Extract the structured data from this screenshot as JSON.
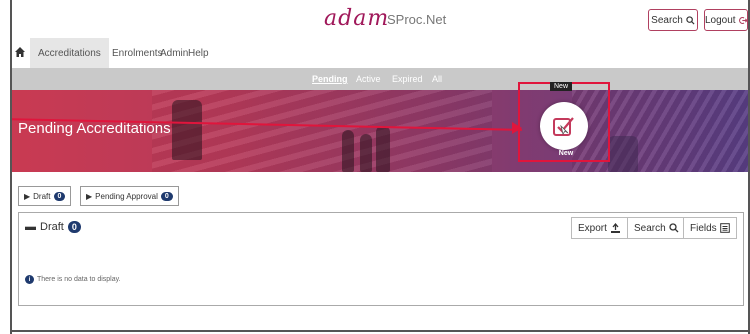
{
  "header": {
    "logo": "adam",
    "product": "SProc.Net",
    "search_label": "Search",
    "logout_label": "Logout"
  },
  "nav": {
    "items": [
      {
        "label": "Accreditations"
      },
      {
        "label": "Enrolments"
      },
      {
        "label": "Admin"
      },
      {
        "label": "Help"
      }
    ]
  },
  "subtabs": {
    "items": [
      {
        "label": "Pending"
      },
      {
        "label": "Active"
      },
      {
        "label": "Expired"
      },
      {
        "label": "All"
      }
    ]
  },
  "banner": {
    "title": "Pending Accreditations",
    "new_tooltip": "New",
    "new_label": "New"
  },
  "filters": {
    "draft_label": "Draft",
    "draft_count": "0",
    "pending_label": "Pending Approval",
    "pending_count": "0"
  },
  "panel": {
    "title": "Draft",
    "count": "0",
    "export_label": "Export",
    "search_label": "Search",
    "fields_label": "Fields",
    "empty_message": "There is no data to display."
  },
  "colors": {
    "brand": "#a0185a",
    "accent": "#e0153c",
    "badge": "#1f3a6e"
  }
}
